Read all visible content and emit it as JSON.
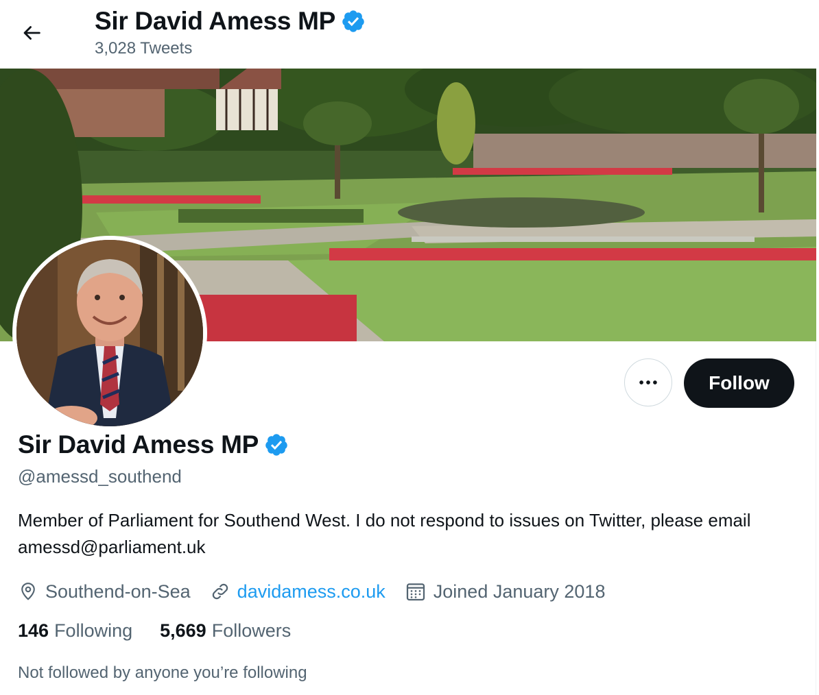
{
  "header": {
    "back_icon": "arrow-left-icon",
    "title": "Sir David Amess MP",
    "tweet_count": "3,028 Tweets"
  },
  "banner": {
    "description_icon": "banner-image"
  },
  "profile": {
    "display_name": "Sir David Amess MP",
    "verified_icon": "verified-badge-icon",
    "handle": "@amessd_southend",
    "bio": "Member of Parliament for Southend West. I do not respond to issues on Twitter, please email amessd@parliament.uk",
    "location": "Southend-on-Sea",
    "website": "davidamess.co.uk",
    "joined": "Joined January 2018",
    "following_count": "146",
    "following_label": "Following",
    "followers_count": "5,669",
    "followers_label": "Followers",
    "followed_by_note": "Not followed by anyone you’re following"
  },
  "actions": {
    "more_icon": "more-horizontal-icon",
    "follow_label": "Follow"
  },
  "colors": {
    "accent": "#1d9bf0",
    "text_primary": "#0f1419",
    "text_secondary": "#536471",
    "follow_bg": "#0f1419",
    "border": "#cfd9de"
  }
}
